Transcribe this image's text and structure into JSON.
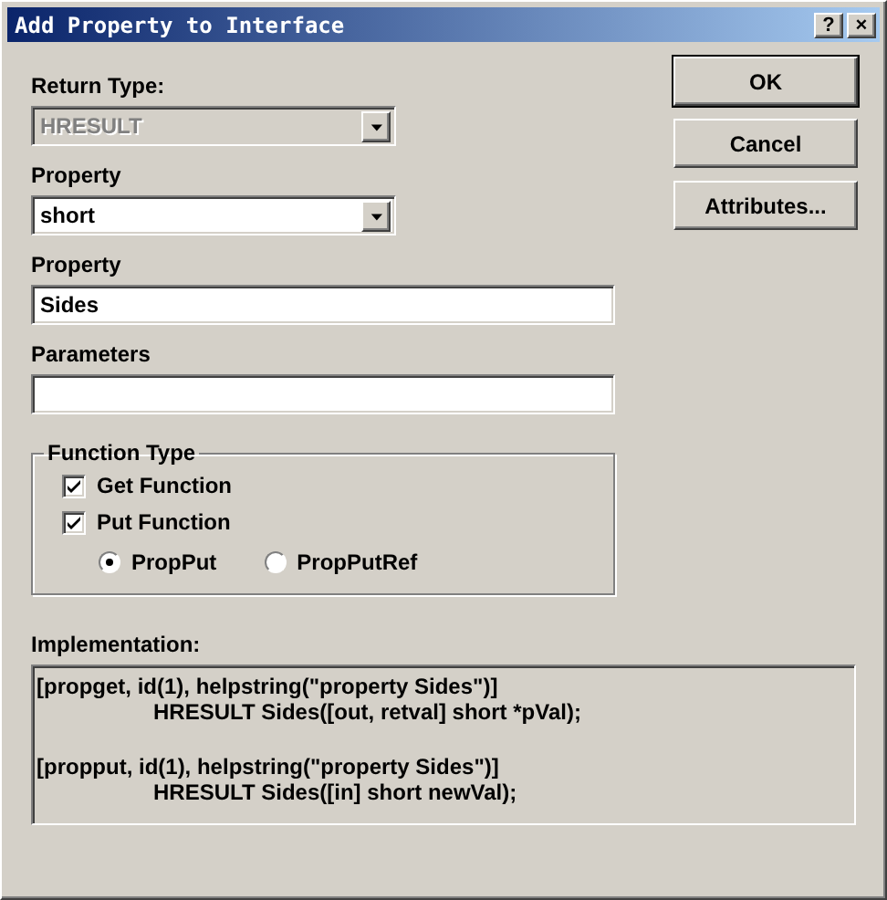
{
  "window": {
    "title": "Add Property to Interface",
    "help_button": "?",
    "close_button": "×"
  },
  "return_type": {
    "label": "Return Type:",
    "value": "HRESULT",
    "disabled": true
  },
  "property_type": {
    "label": "Property",
    "value": "short",
    "disabled": false
  },
  "property_name": {
    "label": "Property",
    "value": "Sides"
  },
  "parameters": {
    "label": "Parameters"
  },
  "function_type": {
    "title": "Function Type",
    "checkboxes": [
      {
        "label": "Get Function",
        "checked": true
      },
      {
        "label": "Put Function",
        "checked": true
      }
    ],
    "radios": [
      {
        "label": "PropPut",
        "selected": true
      },
      {
        "label": "PropPutRef",
        "selected": false
      }
    ]
  },
  "implementation": {
    "label": "Implementation:",
    "entries": [
      {
        "attributes": "[propget, id(1), helpstring(\"property Sides\")]",
        "declaration": "HRESULT Sides([out, retval] short *pVal);"
      },
      {
        "attributes": "[propput, id(1), helpstring(\"property Sides\")]",
        "declaration": "HRESULT Sides([in] short newVal);"
      }
    ]
  },
  "buttons": [
    {
      "label": "OK",
      "default": true
    },
    {
      "label": "Cancel",
      "default": false
    },
    {
      "label": "Attributes...",
      "default": false
    }
  ]
}
